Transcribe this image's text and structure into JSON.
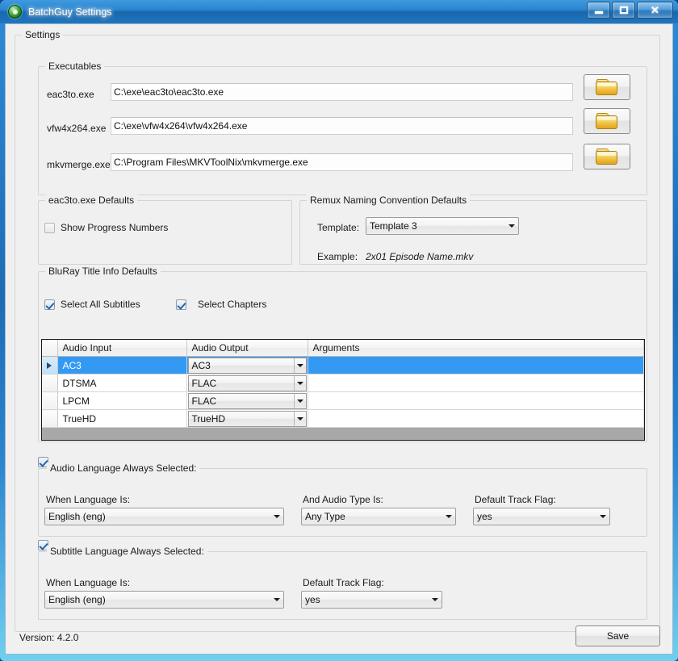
{
  "window": {
    "title": "BatchGuy Settings",
    "app_icon": "batchguy-green-circle-icon",
    "minimize_label": "Minimize",
    "maximize_label": "Maximize",
    "close_label": "Close"
  },
  "settings_group": {
    "title": "Settings"
  },
  "executables": {
    "title": "Executables",
    "rows": [
      {
        "label": "eac3to.exe",
        "value": "C:\\exe\\eac3to\\eac3to.exe",
        "browse": "folder-open-icon"
      },
      {
        "label": "vfw4x264.exe",
        "value": "C:\\exe\\vfw4x264\\vfw4x264.exe",
        "browse": "folder-open-icon"
      },
      {
        "label": "mkvmerge.exe",
        "value": "C:\\Program Files\\MKVToolNix\\mkvmerge.exe",
        "browse": "folder-open-icon"
      }
    ]
  },
  "eac3to_defaults": {
    "title": "eac3to.exe Defaults",
    "show_progress_label": "Show Progress Numbers",
    "show_progress_checked": false
  },
  "remux_naming": {
    "title": "Remux Naming Convention Defaults",
    "template_label": "Template:",
    "template_value": "Template 3",
    "example_label": "Example:",
    "example_value": "2x01 Episode Name.mkv"
  },
  "bluray_defaults": {
    "title": "BluRay Title Info Defaults",
    "select_all_subtitles_label": "Select All Subtitles",
    "select_all_subtitles_checked": true,
    "select_chapters_label": "Select Chapters",
    "select_chapters_checked": true,
    "grid": {
      "headers": [
        "",
        "Audio Input",
        "Audio Output",
        "Arguments"
      ],
      "rows": [
        {
          "marker": "row-selected-arrow",
          "audio_input": "AC3",
          "audio_output": "AC3",
          "arguments": "",
          "selected": true
        },
        {
          "marker": "",
          "audio_input": "DTSMA",
          "audio_output": "FLAC",
          "arguments": "",
          "selected": false
        },
        {
          "marker": "",
          "audio_input": "LPCM",
          "audio_output": "FLAC",
          "arguments": "",
          "selected": false
        },
        {
          "marker": "",
          "audio_input": "TrueHD",
          "audio_output": "TrueHD",
          "arguments": "",
          "selected": false
        }
      ]
    }
  },
  "audio_language": {
    "enabled_checked": true,
    "title": "Audio Language Always Selected:",
    "when_language_label": "When Language Is:",
    "when_language_value": "English (eng)",
    "audio_type_label": "And Audio Type Is:",
    "audio_type_value": "Any Type",
    "default_track_label": "Default Track Flag:",
    "default_track_value": "yes"
  },
  "subtitle_language": {
    "enabled_checked": true,
    "title": "Subtitle Language Always Selected:",
    "when_language_label": "When Language Is:",
    "when_language_value": "English (eng)",
    "default_track_label": "Default Track Flag:",
    "default_track_value": "yes"
  },
  "footer": {
    "version": "Version: 4.2.0",
    "save_label": "Save"
  },
  "colors": {
    "title_bar_blue": "#2b86d0",
    "selection_blue": "#3399f3",
    "client_background": "#f0f0f0",
    "grid_filler_gray": "#a8a8a8"
  }
}
